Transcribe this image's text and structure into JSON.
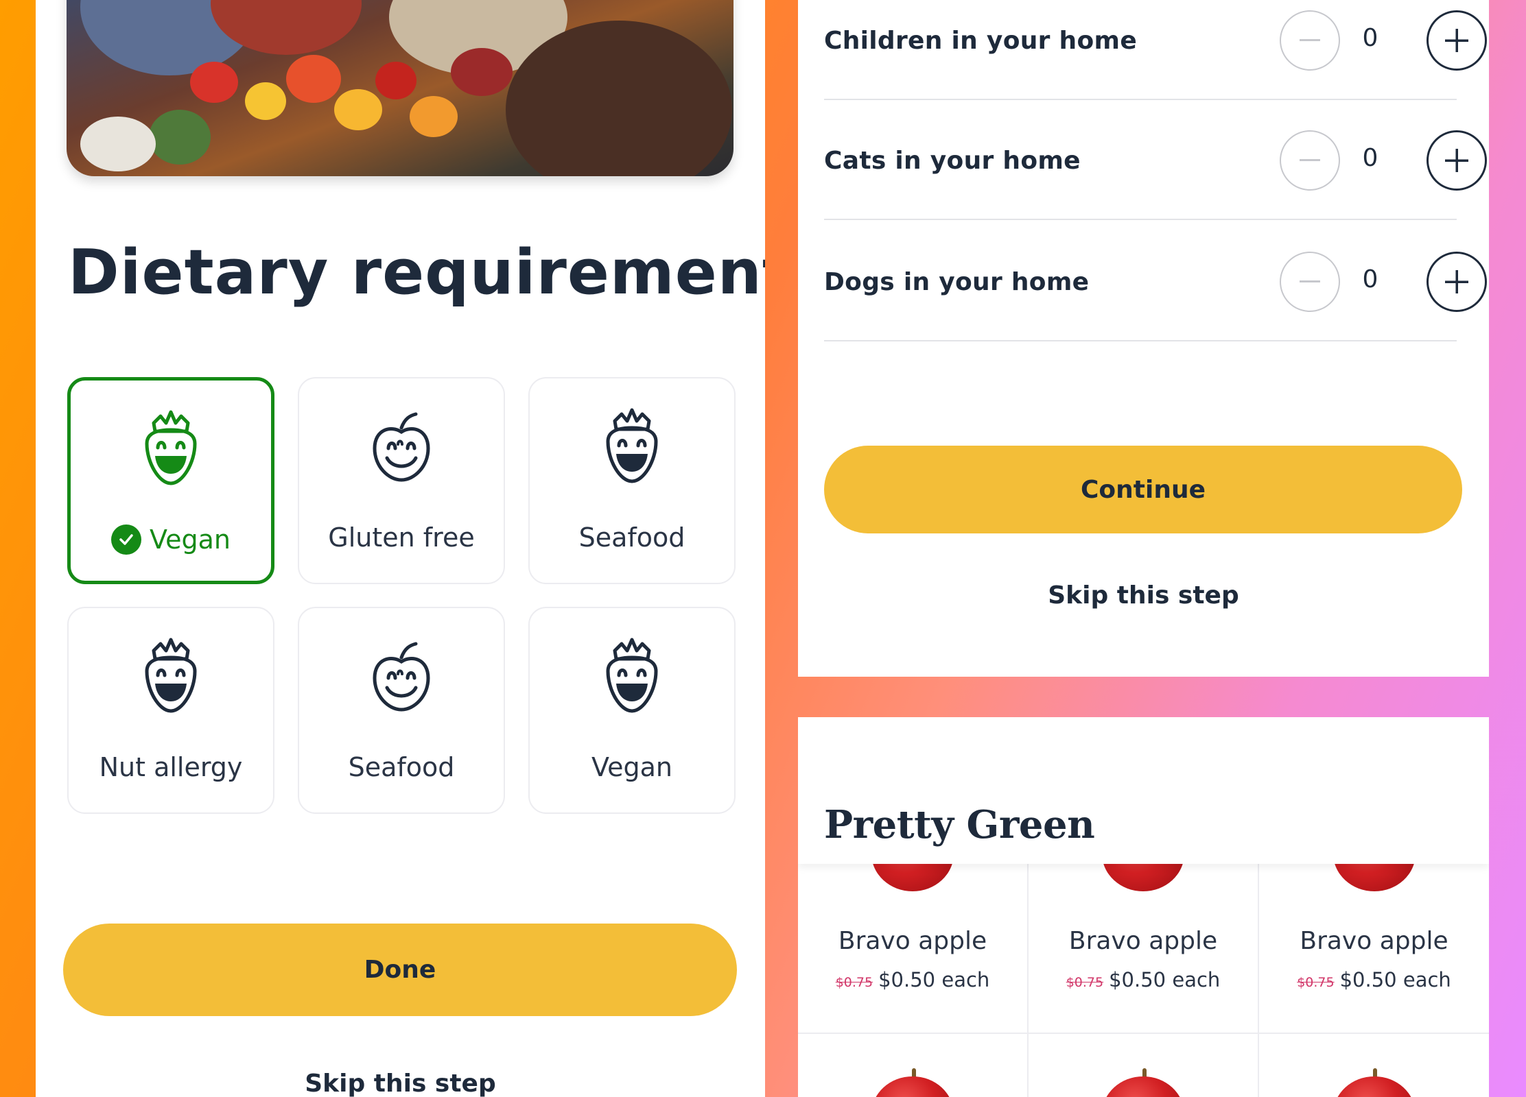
{
  "left_panel": {
    "title": "Dietary requirements",
    "options": [
      {
        "label": "Vegan",
        "icon": "strawberry-face-icon",
        "selected": true
      },
      {
        "label": "Gluten free",
        "icon": "apple-face-icon",
        "selected": false
      },
      {
        "label": "Seafood",
        "icon": "strawberry-face-icon",
        "selected": false
      },
      {
        "label": "Nut allergy",
        "icon": "strawberry-face-icon",
        "selected": false
      },
      {
        "label": "Seafood",
        "icon": "apple-face-icon",
        "selected": false
      },
      {
        "label": "Vegan",
        "icon": "strawberry-face-icon",
        "selected": false
      }
    ],
    "done_label": "Done",
    "skip_label": "Skip this step"
  },
  "right_top": {
    "counters": [
      {
        "label": "Children in your home",
        "value": "0"
      },
      {
        "label": "Cats in your home",
        "value": "0"
      },
      {
        "label": "Dogs in your home",
        "value": "0"
      }
    ],
    "continue_label": "Continue",
    "skip_label": "Skip this step"
  },
  "store": {
    "title": "Pretty Green",
    "products": [
      {
        "name": "Bravo apple",
        "old_price": "$0.75",
        "price": "$0.50 each"
      },
      {
        "name": "Bravo apple",
        "old_price": "$0.75",
        "price": "$0.50 each"
      },
      {
        "name": "Bravo apple",
        "old_price": "$0.75",
        "price": "$0.50 each"
      }
    ]
  },
  "colors": {
    "accent_yellow": "#f3be38",
    "selected_green": "#158a16",
    "text_navy": "#1e2a3b",
    "sale_pink": "#d2386a"
  }
}
